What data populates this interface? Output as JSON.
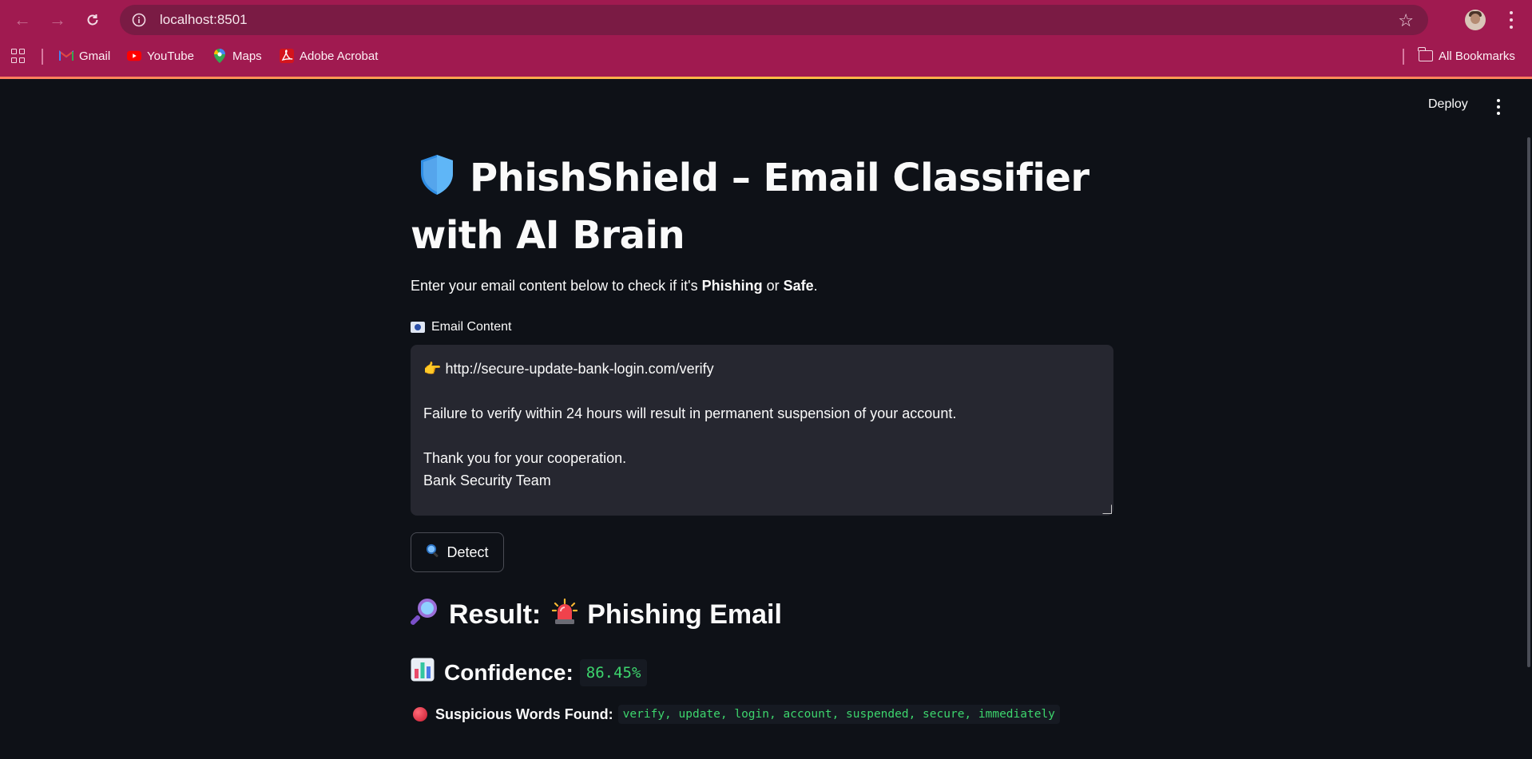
{
  "browser": {
    "url": "localhost:8501",
    "bookmarks": [
      {
        "label": "Gmail",
        "icon": "gmail-icon"
      },
      {
        "label": "YouTube",
        "icon": "youtube-icon"
      },
      {
        "label": "Maps",
        "icon": "maps-icon"
      },
      {
        "label": "Adobe Acrobat",
        "icon": "acrobat-icon"
      }
    ],
    "all_bookmarks_label": "All Bookmarks",
    "theme_color": "#a01a50"
  },
  "app": {
    "deploy_label": "Deploy",
    "title_line1": "PhishShield – Email Classifier",
    "title_line2": "with AI Brain",
    "intro_prefix": "Enter your email content below to check if it's ",
    "intro_phishing": "Phishing",
    "intro_or": " or ",
    "intro_safe": "Safe",
    "intro_suffix": ".",
    "input_label": "Email Content",
    "email_lines": [
      "http://secure-update-bank-login.com/verify",
      "",
      "Failure to verify within 24 hours will result in permanent suspension of your account.",
      "",
      "Thank you for your cooperation.",
      "Bank Security Team"
    ],
    "email_first_line_prefix": "👉",
    "detect_label": "Detect",
    "result_label": "Result:",
    "result_value": "Phishing Email",
    "confidence_label": "Confidence:",
    "confidence_value": "86.45%",
    "suspicious_label": "Suspicious Words Found:",
    "suspicious_words": "verify, update, login, account, suspended, secure, immediately",
    "accent_green": "#3dd56d",
    "background": "#0e1117"
  }
}
